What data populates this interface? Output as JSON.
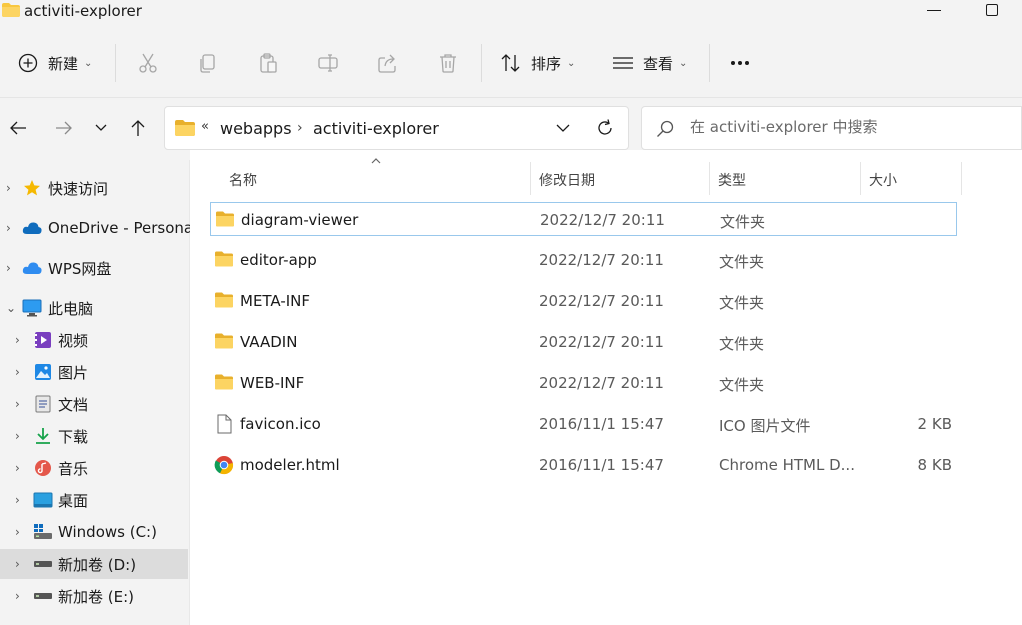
{
  "window": {
    "title": "activiti-explorer"
  },
  "toolbar": {
    "new_label": "新建",
    "sort_label": "排序",
    "view_label": "查看",
    "more_label": "..."
  },
  "address": {
    "overflow": "«",
    "segments": [
      "webapps",
      "activiti-explorer"
    ],
    "separator": "›"
  },
  "search": {
    "placeholder": "在 activiti-explorer 中搜索"
  },
  "sidebar": {
    "items": [
      {
        "label": "快速访问",
        "icon": "star-icon"
      },
      {
        "label": "OneDrive - Persona",
        "icon": "cloud-icon"
      },
      {
        "label": "WPS网盘",
        "icon": "wps-cloud-icon"
      },
      {
        "label": "此电脑",
        "icon": "computer-icon"
      },
      {
        "label": "视频",
        "icon": "video-icon"
      },
      {
        "label": "图片",
        "icon": "picture-icon"
      },
      {
        "label": "文档",
        "icon": "document-icon"
      },
      {
        "label": "下载",
        "icon": "download-icon"
      },
      {
        "label": "音乐",
        "icon": "music-icon"
      },
      {
        "label": "桌面",
        "icon": "desktop-icon"
      },
      {
        "label": "Windows (C:)",
        "icon": "windows-drive-icon"
      },
      {
        "label": "新加卷 (D:)",
        "icon": "drive-icon"
      },
      {
        "label": "新加卷 (E:)",
        "icon": "drive-icon"
      }
    ]
  },
  "columns": {
    "name": "名称",
    "date": "修改日期",
    "type": "类型",
    "size": "大小",
    "sort_indicator": "^"
  },
  "files": [
    {
      "name": "diagram-viewer",
      "date": "2022/12/7 20:11",
      "type": "文件夹",
      "size": "",
      "icon": "folder-icon"
    },
    {
      "name": "editor-app",
      "date": "2022/12/7 20:11",
      "type": "文件夹",
      "size": "",
      "icon": "folder-icon"
    },
    {
      "name": "META-INF",
      "date": "2022/12/7 20:11",
      "type": "文件夹",
      "size": "",
      "icon": "folder-icon"
    },
    {
      "name": "VAADIN",
      "date": "2022/12/7 20:11",
      "type": "文件夹",
      "size": "",
      "icon": "folder-icon"
    },
    {
      "name": "WEB-INF",
      "date": "2022/12/7 20:11",
      "type": "文件夹",
      "size": "",
      "icon": "folder-icon"
    },
    {
      "name": "favicon.ico",
      "date": "2016/11/1 15:47",
      "type": "ICO 图片文件",
      "size": "2 KB",
      "icon": "file-icon"
    },
    {
      "name": "modeler.html",
      "date": "2016/11/1 15:47",
      "type": "Chrome HTML D...",
      "size": "8 KB",
      "icon": "chrome-icon"
    }
  ],
  "colors": {
    "accent": "#0067c0",
    "folder": "#f8c73f",
    "selected_border": "#99c8ec",
    "sidebar_selected": "#dcdcdc"
  }
}
